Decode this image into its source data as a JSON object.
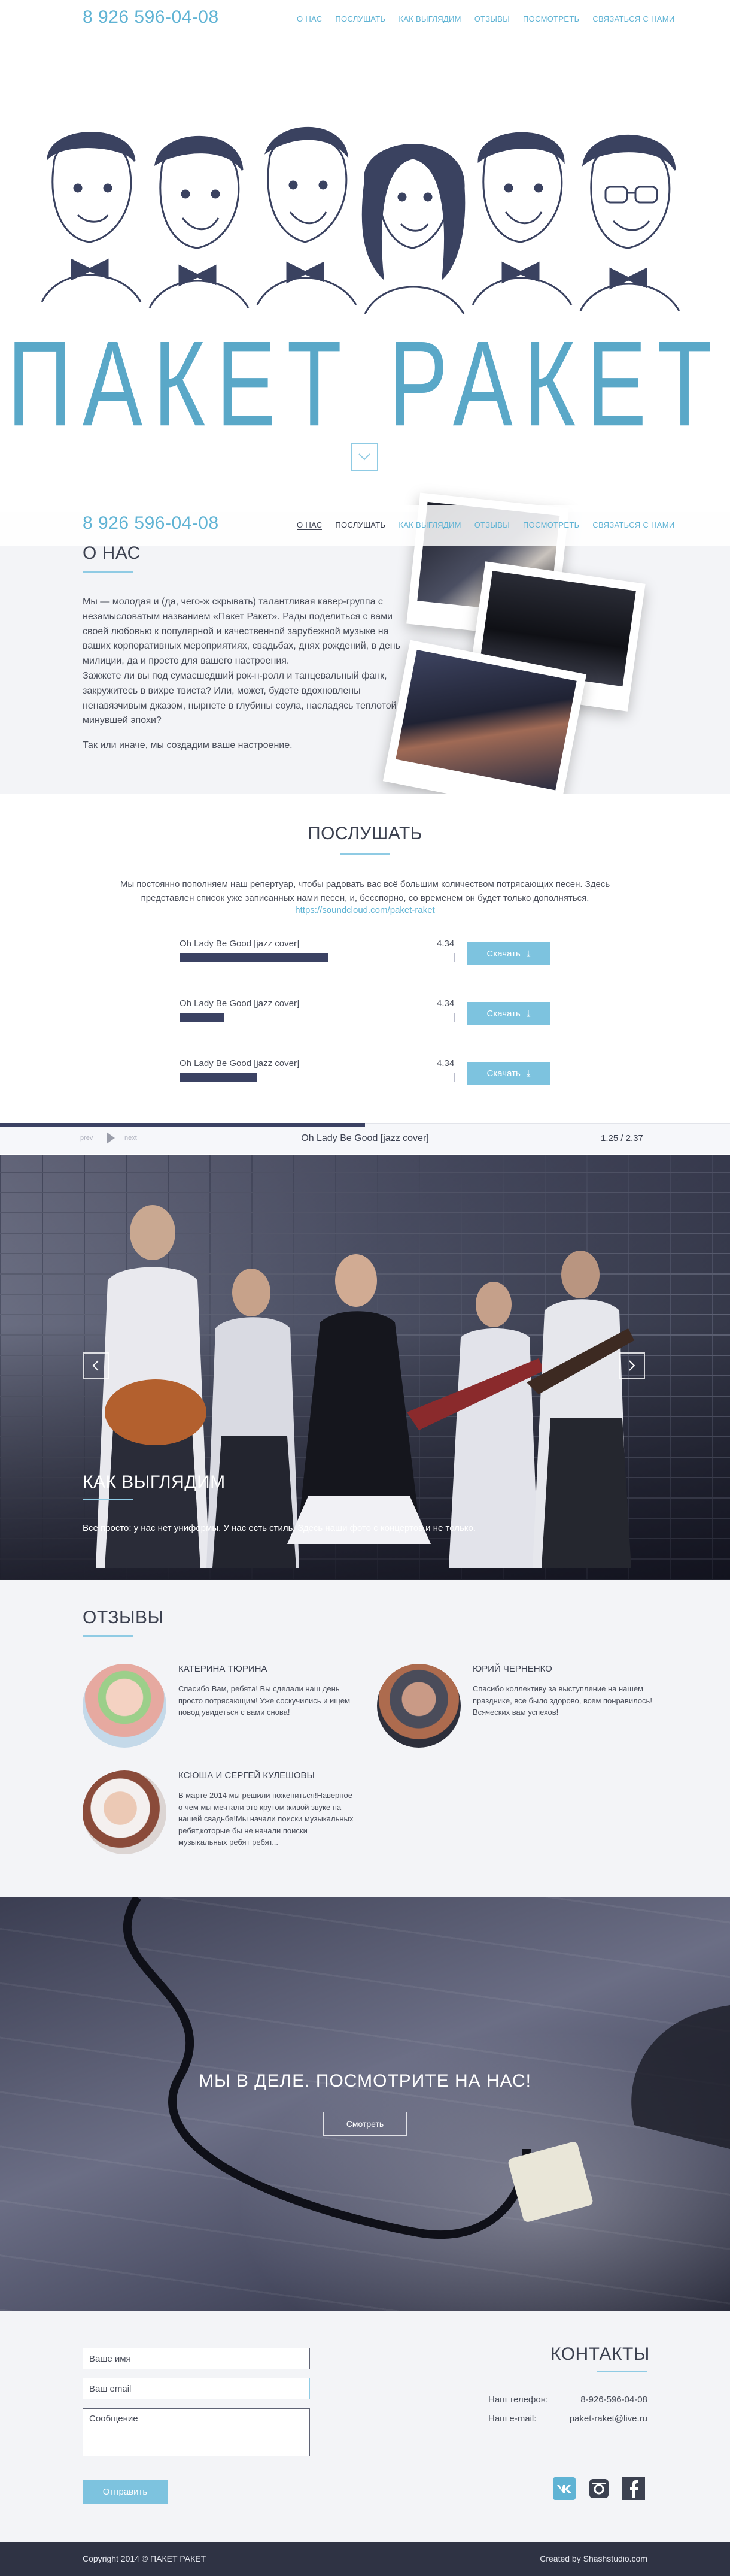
{
  "header": {
    "phone": "8 926 596-04-08",
    "nav": [
      {
        "label": "О НАС"
      },
      {
        "label": "ПОСЛУШАТЬ"
      },
      {
        "label": "КАК ВЫГЛЯДИМ"
      },
      {
        "label": "ОТЗЫВЫ"
      },
      {
        "label": "ПОСМОТРЕТЬ"
      },
      {
        "label": "СВЯЗАТЬСЯ С НАМИ"
      }
    ]
  },
  "hero": {
    "logo": "ПАКЕТ РАКЕТ",
    "scroll_icon": "chevron-down-icon"
  },
  "about": {
    "title": "О НАС",
    "p1": "Мы — молодая и (да, чего-ж скрывать) талантливая кавер-группа с незамысловатым названием «Пакет Ракет». Рады поделиться с вами своей любовью к популярной и качественной зарубежной музыке на ваших корпоративных мероприятиях, свадьбах, днях рождений, в день милиции, да и просто для вашего настроения.",
    "p2": "Зажжете ли вы под сумасшедший рок-н-ролл и танцевальный фанк, закружитесь в вихре твиста? Или, может, будете вдохновлены ненавязчивым джазом, нырнете в глубины соула, насладясь теплотой минувшей эпохи?",
    "p3": "Так или иначе, мы создадим ваше настроение."
  },
  "listen": {
    "title": "ПОСЛУШАТЬ",
    "intro": "Мы постоянно пополняем наш репертуар, чтобы радовать вас всё большим количеством потрясающих песен. Здесь представлен список уже записанных нами песен, и, бесспорно, со временем он будет только дополняться.",
    "link": "https://soundcloud.com/paket-raket",
    "tracks": [
      {
        "title": "Oh Lady Be Good [jazz cover]",
        "duration": "4.34",
        "progress": 0.54,
        "button": "Скачать"
      },
      {
        "title": "Oh Lady Be Good [jazz cover]",
        "duration": "4.34",
        "progress": 0.16,
        "button": "Скачать"
      },
      {
        "title": "Oh Lady Be Good [jazz cover]",
        "duration": "4.34",
        "progress": 0.28,
        "button": "Скачать"
      }
    ],
    "download_icon": "download-icon"
  },
  "player": {
    "prev": "prev",
    "next": "next",
    "title": "Oh Lady Be Good [jazz cover]",
    "time": "1.25 / 2.37",
    "progress": 0.5
  },
  "look": {
    "title": "КАК ВЫГЛЯДИМ",
    "text": "Все просто: у нас нет униформы. У нас есть стиль. Здесь наши фото с концертов и не только."
  },
  "reviews": {
    "title": "ОТЗЫВЫ",
    "items": [
      {
        "name": "КАТЕРИНА ТЮРИНА",
        "text": "Спасибо Вам, ребята! Вы сделали наш день просто потрясающим! Уже соскучились и ищем повод увидеться с вами снова!"
      },
      {
        "name": "ЮРИЙ ЧЕРНЕНКО",
        "text": "Спасибо коллективу за выступление на нашем празднике, все было здорово, всем понравилось! Всяческих вам успехов!"
      },
      {
        "name": "КСЮША И СЕРГЕЙ КУЛЕШОВЫ",
        "text": "В марте 2014 мы решили пожениться!Наверное о чем мы мечтали это крутом живой звуке на нашей свадьбе!Мы начали поиски музыкальных ребят,которые бы не начали поиски музыкальных ребят ребят..."
      }
    ]
  },
  "action": {
    "title": "МЫ В ДЕЛЕ. ПОСМОТРИТЕ НА НАС!",
    "button": "Смотреть"
  },
  "contacts": {
    "title": "КОНТАКТЫ",
    "name_placeholder": "Ваше имя",
    "email_placeholder": "Ваш email",
    "message_placeholder": "Сообщение",
    "submit": "Отправить",
    "phone_label": "Наш телефон:",
    "phone_value": "8-926-596-04-08",
    "email_label": "Наш e-mail:",
    "email_value": "paket-raket@live.ru",
    "socials": [
      "vk-icon",
      "instagram-icon",
      "facebook-icon"
    ]
  },
  "footer": {
    "copyright": "Copyright 2014 © ПАКЕТ РАКЕТ",
    "credits": "Created by Shashstudio.com"
  }
}
